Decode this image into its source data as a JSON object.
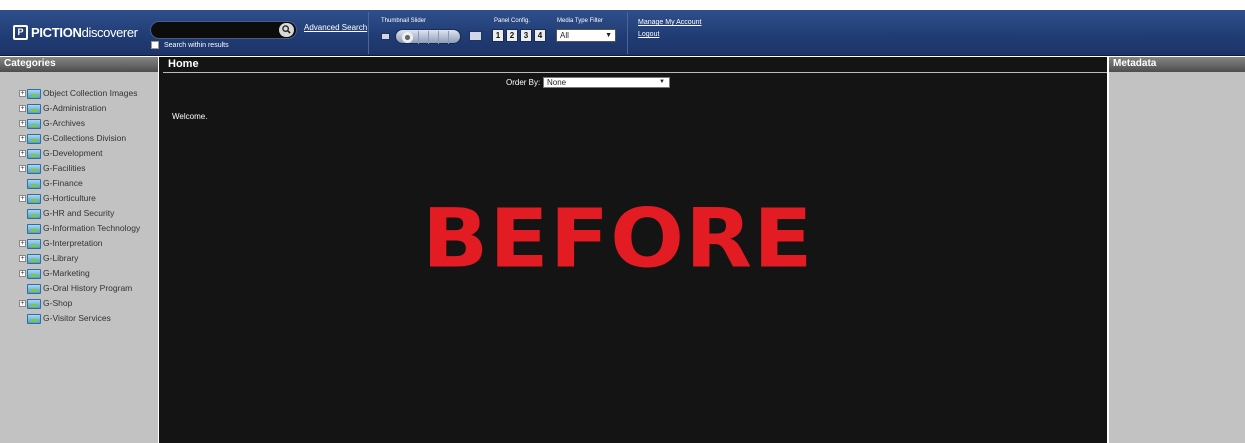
{
  "brand": {
    "mark": "P",
    "bold": "PICTION",
    "thin": "discoverer"
  },
  "search": {
    "value": "",
    "button_icon": "magnifier-icon",
    "advanced_link": "Advanced Search",
    "within_label": "Search within results"
  },
  "controls": {
    "thumbnail_slider_label": "Thumbnail Slider",
    "panel_config_label": "Panel Config.",
    "panel_buttons": [
      "1",
      "2",
      "3",
      "4"
    ],
    "media_type_label": "Media Type Filter",
    "media_type_value": "All"
  },
  "account": {
    "manage_link": "Manage My Account",
    "logout_link": "Logout"
  },
  "categories": {
    "header": "Categories",
    "items": [
      {
        "label": "Object Collection Images",
        "expandable": true
      },
      {
        "label": "G-Administration",
        "expandable": true
      },
      {
        "label": "G-Archives",
        "expandable": true
      },
      {
        "label": "G-Collections Division",
        "expandable": true
      },
      {
        "label": "G-Development",
        "expandable": true
      },
      {
        "label": "G-Facilities",
        "expandable": true
      },
      {
        "label": "G-Finance",
        "expandable": false
      },
      {
        "label": "G-Horticulture",
        "expandable": true
      },
      {
        "label": "G-HR and Security",
        "expandable": false
      },
      {
        "label": "G-Information Technology",
        "expandable": false
      },
      {
        "label": "G-Interpretation",
        "expandable": true
      },
      {
        "label": "G-Library",
        "expandable": true
      },
      {
        "label": "G-Marketing",
        "expandable": true
      },
      {
        "label": "G-Oral History Program",
        "expandable": false
      },
      {
        "label": "G-Shop",
        "expandable": true
      },
      {
        "label": "G-Visitor Services",
        "expandable": false
      }
    ]
  },
  "main": {
    "title": "Home",
    "order_by_label": "Order By:",
    "order_by_value": "None",
    "welcome": "Welcome.",
    "overlay_text": "BEFORE"
  },
  "metadata": {
    "header": "Metadata"
  },
  "colors": {
    "topbar": "#213d75",
    "panel_bg": "#c2c2c2",
    "main_bg": "#141414",
    "overlay": "#e31b23"
  }
}
